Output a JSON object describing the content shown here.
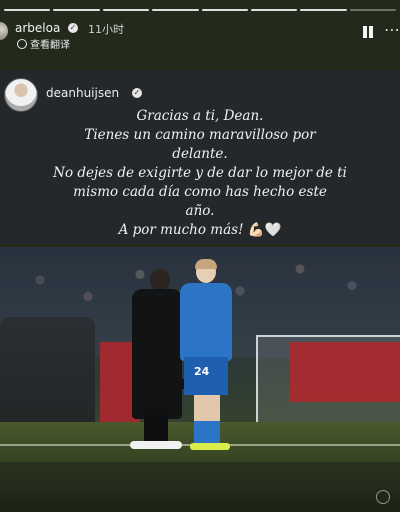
{
  "story": {
    "segments": 8,
    "active_segment": 7
  },
  "header": {
    "username": "arbeloa",
    "time_ago": "11小时",
    "translate_label": "查看翻译",
    "more_glyph": "⋯"
  },
  "card": {
    "username": "deanhuijsen",
    "quote_lines": [
      "Gracias a ti, Dean.",
      "Tienes un camino maravilloso por",
      "delante.",
      "No dejes de exigirte y de dar lo mejor de ti",
      "mismo cada día como has hecho este",
      "año.",
      "A por mucho más!"
    ],
    "quote_emoji": "💪🏻🤍"
  },
  "photo": {
    "player_number": "24"
  },
  "icons": {
    "verified": "verified-icon",
    "pause": "pause-icon",
    "more": "more-icon",
    "translate": "globe-icon"
  }
}
